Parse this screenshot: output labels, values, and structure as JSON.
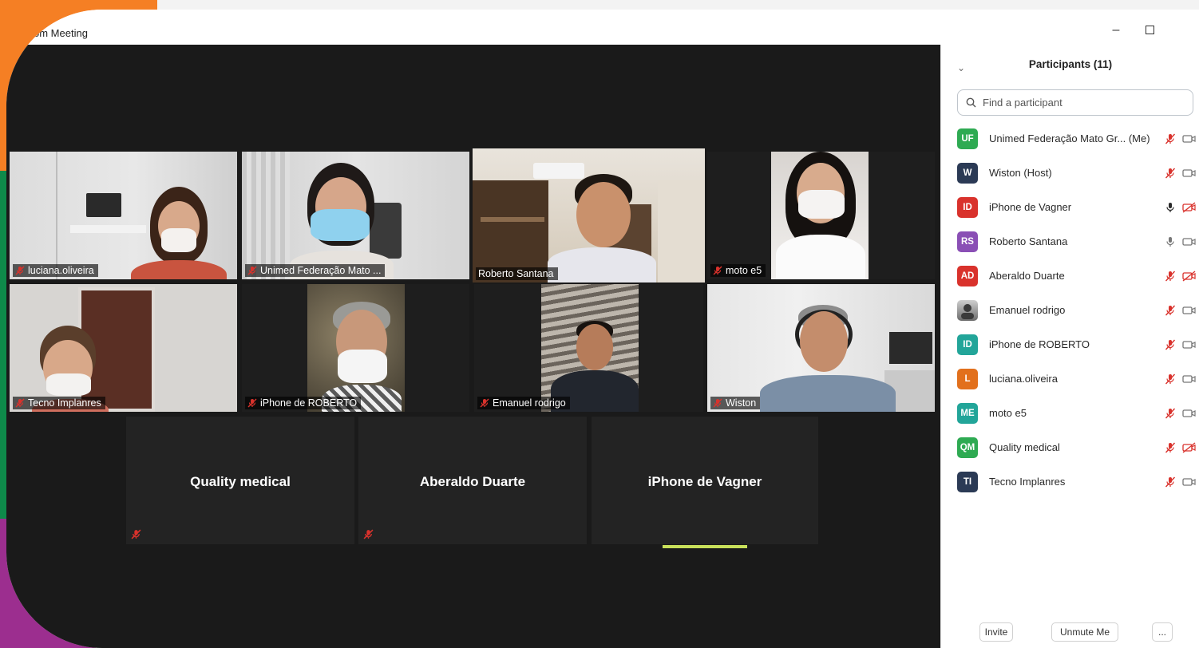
{
  "window": {
    "title": "om Meeting",
    "minimize_label": "–"
  },
  "gallery": {
    "tiles": [
      {
        "name": "luciana.oliveira",
        "muted": true
      },
      {
        "name": "Unimed Federação Mato ...",
        "muted": true
      },
      {
        "name": "Roberto Santana",
        "muted": false,
        "active": true
      },
      {
        "name": "moto e5",
        "muted": true
      },
      {
        "name": "Tecno Implanres",
        "muted": true
      },
      {
        "name": "iPhone de ROBERTO",
        "muted": true
      },
      {
        "name": "Emanuel rodrigo",
        "muted": true
      },
      {
        "name": "Wiston",
        "muted": true
      }
    ],
    "audio_tiles": [
      {
        "name": "Quality medical",
        "muted": true
      },
      {
        "name": "Aberaldo Duarte",
        "muted": true
      },
      {
        "name": "iPhone de Vagner",
        "muted": false,
        "speaking": true
      }
    ]
  },
  "participants": {
    "title": "Participants (11)",
    "search_placeholder": "Find a participant",
    "items": [
      {
        "initials": "UF",
        "name": "Unimed Federação Mato Gr... (Me)",
        "color": "#2eaa52",
        "mic": "muted",
        "cam": "on"
      },
      {
        "initials": "W",
        "name": "Wiston (Host)",
        "color": "#2b3a55",
        "mic": "muted",
        "cam": "on"
      },
      {
        "initials": "ID",
        "name": "iPhone de Vagner",
        "color": "#d9322c",
        "mic": "on-active",
        "cam": "off"
      },
      {
        "initials": "RS",
        "name": "Roberto Santana",
        "color": "#8a4fb5",
        "mic": "on",
        "cam": "on"
      },
      {
        "initials": "AD",
        "name": "Aberaldo Duarte",
        "color": "#d9322c",
        "mic": "muted",
        "cam": "off"
      },
      {
        "initials": "",
        "name": "Emanuel rodrigo",
        "color": "#777777",
        "photo": true,
        "mic": "muted",
        "cam": "on"
      },
      {
        "initials": "ID",
        "name": "iPhone de ROBERTO",
        "color": "#22a599",
        "mic": "muted",
        "cam": "on"
      },
      {
        "initials": "L",
        "name": "luciana.oliveira",
        "color": "#e2701c",
        "mic": "muted",
        "cam": "on"
      },
      {
        "initials": "ME",
        "name": "moto e5",
        "color": "#22a599",
        "mic": "muted",
        "cam": "on"
      },
      {
        "initials": "QM",
        "name": "Quality medical",
        "color": "#2eaa52",
        "mic": "muted",
        "cam": "off"
      },
      {
        "initials": "TI",
        "name": "Tecno Implanres",
        "color": "#2b3a55",
        "mic": "muted",
        "cam": "on"
      }
    ],
    "footer": {
      "invite_label": "Invite",
      "unmute_label": "Unmute Me",
      "more_label": "..."
    }
  },
  "colors": {
    "accent_speaking": "#c8e05a",
    "mute_red": "#d9322c",
    "gallery_bg": "#1a1a1a"
  }
}
